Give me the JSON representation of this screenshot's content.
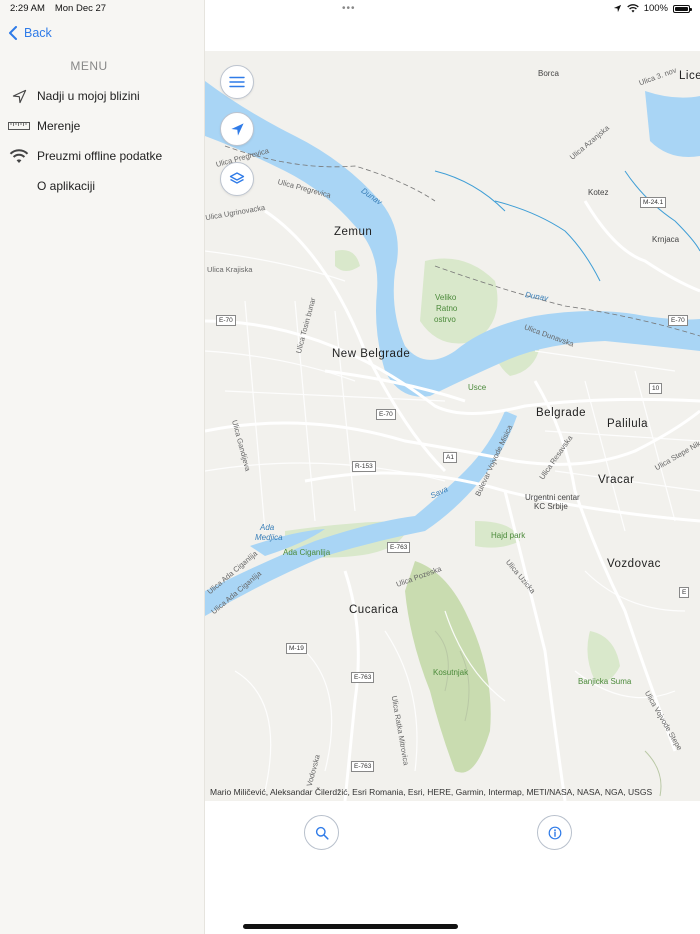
{
  "status_bar": {
    "time": "2:29 AM",
    "date": "Mon Dec 27",
    "battery": "100%"
  },
  "sidebar": {
    "back_label": "Back",
    "menu_title": "MENU",
    "items": [
      {
        "label": "Nadji u mojoj blizini",
        "icon": "navigation-arrow-icon"
      },
      {
        "label": "Merenje",
        "icon": "ruler-icon"
      },
      {
        "label": "Preuzmi offline podatke",
        "icon": "wifi-icon"
      },
      {
        "label": "O aplikaciji",
        "icon": ""
      }
    ]
  },
  "map": {
    "places": {
      "borca": "Borca",
      "lice": "Lice",
      "kotez": "Kotez",
      "krnjaca": "Krnjaca",
      "zemun": "Zemun",
      "new_belgrade": "New Belgrade",
      "belgrade": "Belgrade",
      "palilula": "Palilula",
      "vracar": "Vracar",
      "vozdovac": "Vozdovac",
      "cucarica": "Cucarica",
      "veliko": "Veliko",
      "ratno": "Ratno",
      "ostrvo": "ostrvo",
      "usce": "Usce",
      "hajd_park": "Hajd park",
      "ada_ciganlija": "Ada Ciganlija",
      "ada": "Ada",
      "medjica": "Medjica",
      "kosutnjak": "Kosutnjak",
      "banjicka_suma": "Banjicka Suma",
      "urgentni": "Urgentni centar",
      "kc_srbije": "KC Srbije"
    },
    "water": {
      "dunav1": "Dunav",
      "dunav2": "Dunav",
      "sava": "Sava"
    },
    "streets": {
      "pregreviča1": "Ulica Pregrevica",
      "pregreviča2": "Ulica Pregrevica",
      "ugrinovacka": "Ulica Ugrinovacka",
      "krajiska": "Ulica Krajiska",
      "tosin_bunar": "Ulica Tosin bunar",
      "gandijeva": "Ulica Gandijeva",
      "dunavska": "Ulica Dunavska",
      "bulevar_vojvode_misica": "Bulevar Vojvode Misica",
      "resavska": "Ulica Resavska",
      "uzicka": "Ulica Uzicka",
      "pozeska": "Ulica Pozeska",
      "ratka_mitrovica": "Ulica Ratka Mitrovica",
      "vojvode_stepe": "Ulica Vojvode Stepe",
      "stepe_nik": "Ulica Stepe Nik",
      "azanjska": "Ulica Azanjska",
      "ulica3": "Ulica 3. nov",
      "ulica_ada_ciganlija": "Ulica Ada Ciganlija",
      "ulica_ada_ciganlija2": "Ulica Ada Ciganlija",
      "vodovska": "Vodovska"
    },
    "shields": {
      "e70a": "E-70",
      "e70b": "E-70",
      "e70c": "E-70",
      "a1": "A1",
      "r153": "R-153",
      "e763a": "E-763",
      "e763b": "E-763",
      "e763c": "E-763",
      "m19": "M-19",
      "m241": "M-24.1",
      "r10": "10",
      "e75": "E"
    },
    "attribution": "Mario Miličević, Aleksandar Čilerdžić, Esri Romania, Esri, HERE, Garmin, Intermap, METI/NASA, NASA, NGA, USGS"
  },
  "colors": {
    "accent": "#2f7be8",
    "water": "#a9d5f5",
    "park": "#d4e4c0",
    "land": "#f2f1ed",
    "road": "#ffffff"
  }
}
